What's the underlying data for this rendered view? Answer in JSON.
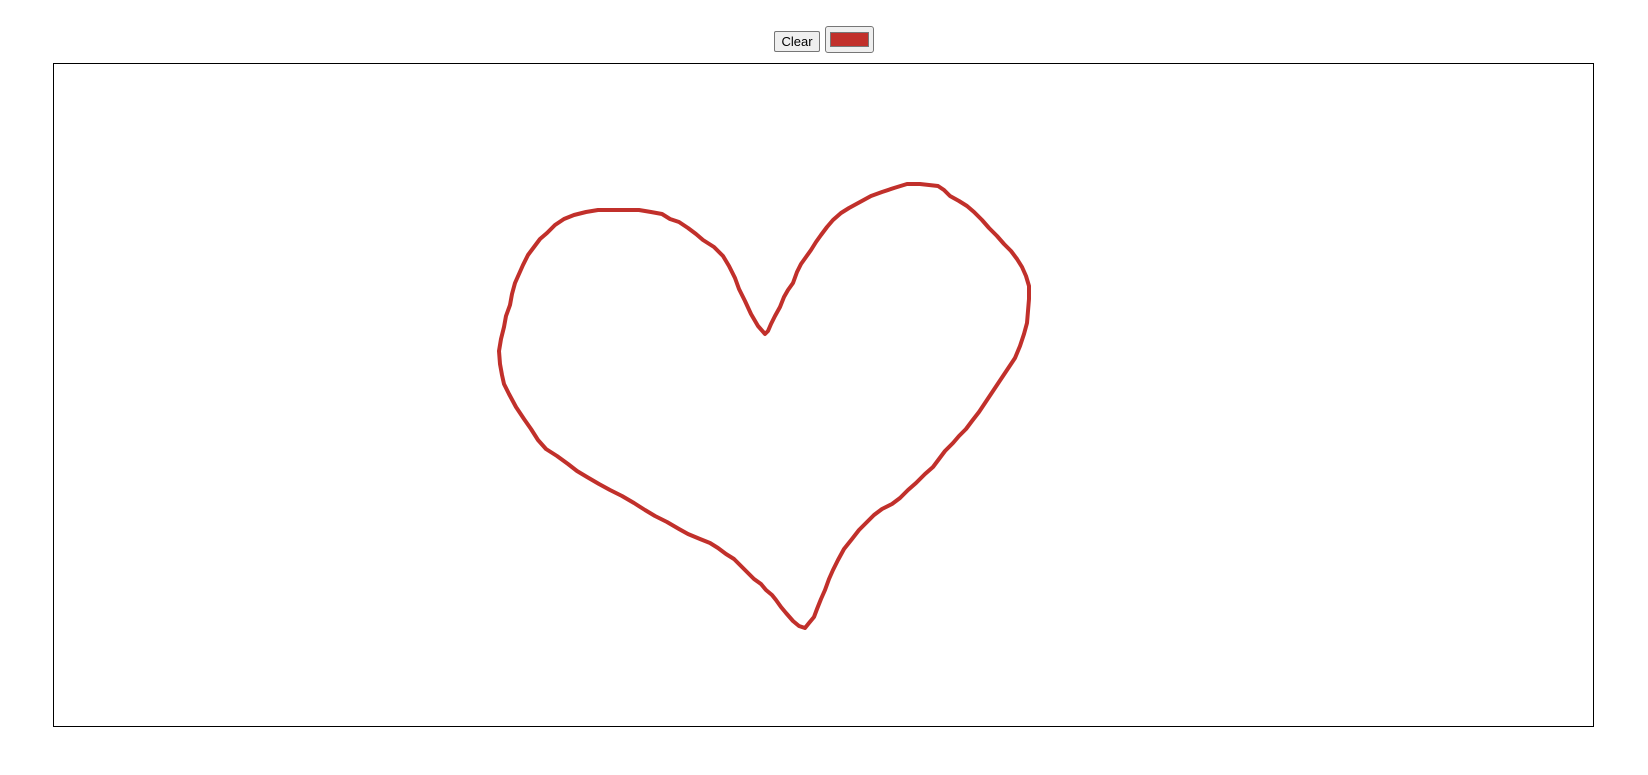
{
  "toolbar": {
    "clear_label": "Clear",
    "stroke_color": "#c1302b"
  },
  "canvas": {
    "background": "#ffffff",
    "drawing": "heart"
  }
}
